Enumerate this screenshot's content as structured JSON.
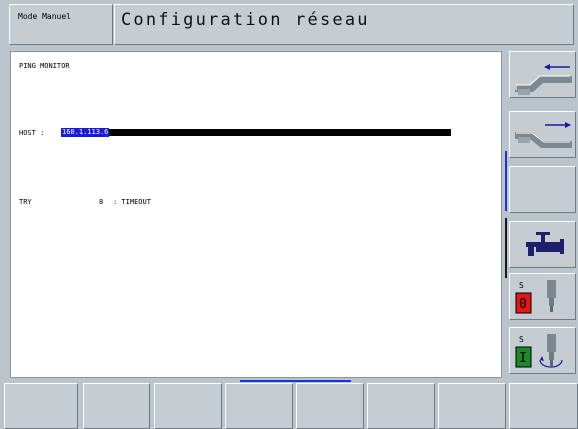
{
  "header": {
    "mode_label": "Mode Manuel",
    "title": "Configuration réseau"
  },
  "main": {
    "ping_title": "PING MONITOR",
    "host_label": "HOST :",
    "host_value": "160.1.113.6",
    "try_label": "TRY",
    "try_count": "8",
    "try_result": ": TIMEOUT"
  },
  "side_softkeys": [
    {
      "icon": "ramp-arrow-left-icon"
    },
    {
      "icon": "ramp-arrow-right-icon"
    },
    {
      "icon": ""
    },
    {
      "icon": "coolant-tap-icon"
    },
    {
      "icon": "spindle-off-icon",
      "letter": "S",
      "badge": "0",
      "badge_color": "#e01818"
    },
    {
      "icon": "spindle-on-icon",
      "letter": "S",
      "badge": "I",
      "badge_color": "#1a8a2a"
    }
  ],
  "bottom_softkeys": [
    "",
    "",
    "",
    "",
    "",
    "",
    "",
    ""
  ],
  "colors": {
    "background": "#b9c4cc",
    "panel": "#ffffff",
    "highlight": "#1b1bd8",
    "indicator": "#1a37d6"
  }
}
